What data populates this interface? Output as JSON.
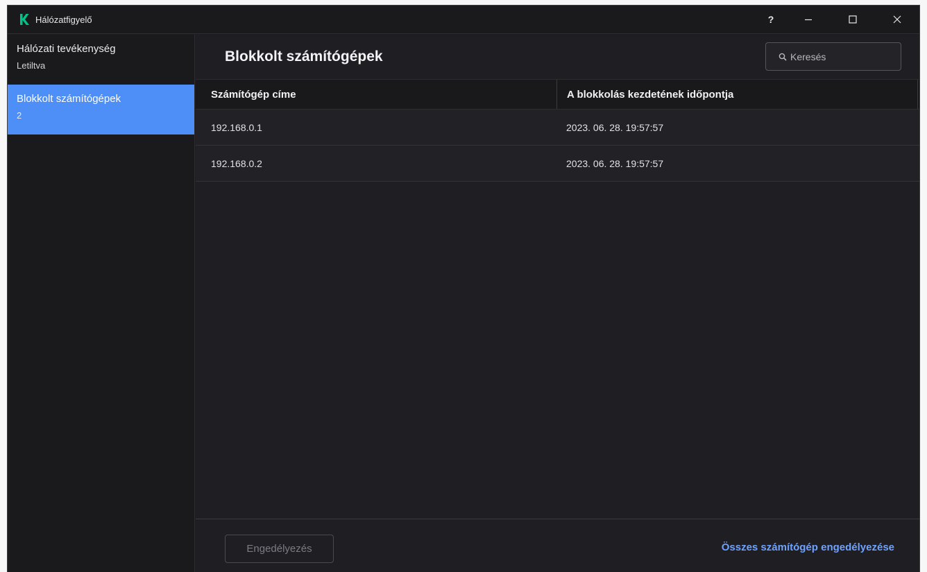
{
  "window": {
    "title": "Hálózatfigyelő"
  },
  "titlebar": {
    "help_label": "?",
    "icons": [
      "kaspersky-logo-icon",
      "minimize-icon",
      "maximize-icon",
      "close-icon"
    ]
  },
  "sidebar": {
    "items": [
      {
        "label": "Hálózati tevékenység",
        "sub": "Letiltva",
        "active": false
      },
      {
        "label": "Blokkolt számítógépek",
        "sub": "2",
        "active": true
      }
    ]
  },
  "main": {
    "title": "Blokkolt számítógépek",
    "search": {
      "placeholder": "Keresés"
    },
    "table": {
      "columns": [
        "Számítógép címe",
        "A blokkolás kezdetének időpontja"
      ],
      "rows": [
        [
          "192.168.0.1",
          "2023. 06. 28. 19:57:57"
        ],
        [
          "192.168.0.2",
          "2023. 06. 28. 19:57:57"
        ]
      ]
    },
    "footer": {
      "allow_button": "Engedélyezés",
      "allow_all_link": "Összes számítógép engedélyezése"
    }
  },
  "colors": {
    "accent": "#4d8ef7",
    "link": "#6ea2ff",
    "logo": "#00c389",
    "background": "#1f1f23"
  }
}
